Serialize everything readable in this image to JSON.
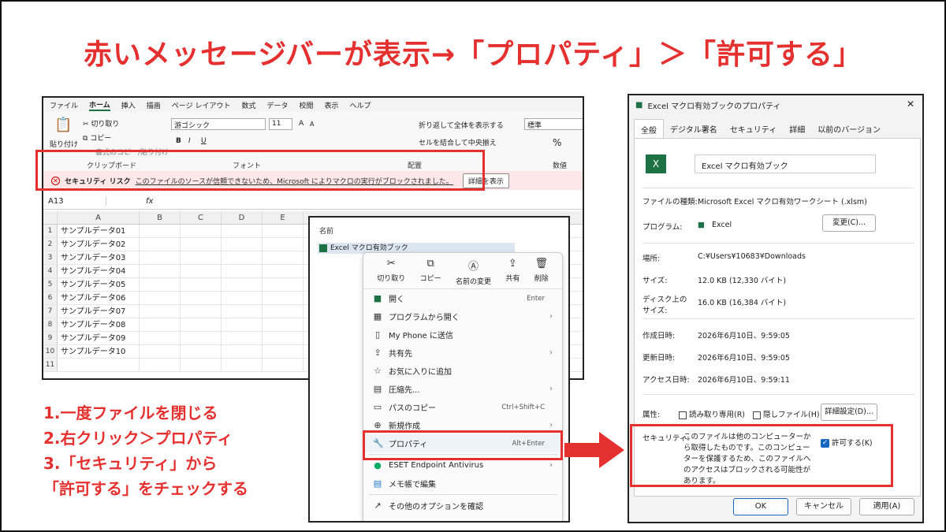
{
  "title": "赤いメッセージバーが表示→「プロパティ」＞「許可する」",
  "excel": {
    "menu": [
      "ファイル",
      "ホーム",
      "挿入",
      "描画",
      "ページ レイアウト",
      "数式",
      "データ",
      "校閲",
      "表示",
      "ヘルプ"
    ],
    "clipboard": {
      "paste": "貼り付け",
      "cut": "切り取り",
      "copy": "コピー",
      "format": "書式のコピー/貼り付け",
      "label": "クリップボード"
    },
    "font": {
      "name": "游ゴシック",
      "size": "11",
      "grow": "A",
      "shrink": "A",
      "bold": "B",
      "italic": "I",
      "underline": "U",
      "label": "フォント"
    },
    "align": {
      "wrap": "折り返して全体を表示する",
      "merge": "セルを結合して中央揃え",
      "label": "配置"
    },
    "number": {
      "format": "標準",
      "label": "数値",
      "percent": "%"
    },
    "security": {
      "heading": "セキュリティ リスク",
      "message": "このファイルのソースが信頼できないため、Microsoft によりマクロの実行がブロックされました。",
      "button": "詳細を表示"
    },
    "namebox": "A13",
    "fx": "fx",
    "columns": [
      "A",
      "B",
      "C",
      "D",
      "E"
    ],
    "rows": [
      {
        "n": "1",
        "v": "サンプルデータ01"
      },
      {
        "n": "2",
        "v": "サンプルデータ02"
      },
      {
        "n": "3",
        "v": "サンプルデータ03"
      },
      {
        "n": "4",
        "v": "サンプルデータ04"
      },
      {
        "n": "5",
        "v": "サンプルデータ05"
      },
      {
        "n": "6",
        "v": "サンプルデータ06"
      },
      {
        "n": "7",
        "v": "サンプルデータ07"
      },
      {
        "n": "8",
        "v": "サンプルデータ08"
      },
      {
        "n": "9",
        "v": "サンプルデータ09"
      },
      {
        "n": "10",
        "v": "サンプルデータ10"
      },
      {
        "n": "11",
        "v": ""
      }
    ]
  },
  "explorer": {
    "header": "名前",
    "file": "Excel マクロ有効ブック",
    "top_actions": [
      "切り取り",
      "コピー",
      "名前の変更",
      "共有",
      "削除"
    ],
    "items": [
      {
        "label": "開く",
        "shortcut": "Enter",
        "arrow": ""
      },
      {
        "label": "プログラムから開く",
        "shortcut": "",
        "arrow": "›"
      },
      {
        "label": "My Phone に送信",
        "shortcut": "",
        "arrow": ""
      },
      {
        "label": "共有先",
        "shortcut": "",
        "arrow": "›"
      },
      {
        "label": "お気に入りに追加",
        "shortcut": "",
        "arrow": ""
      },
      {
        "label": "圧縮先...",
        "shortcut": "",
        "arrow": "›"
      },
      {
        "label": "パスのコピー",
        "shortcut": "Ctrl+Shift+C",
        "arrow": ""
      },
      {
        "label": "新規作成",
        "shortcut": "",
        "arrow": "›"
      },
      {
        "label": "プロパティ",
        "shortcut": "Alt+Enter",
        "arrow": ""
      },
      {
        "label": "ESET Endpoint Antivirus",
        "shortcut": "",
        "arrow": "›"
      },
      {
        "label": "メモ帳で編集",
        "shortcut": "",
        "arrow": ""
      },
      {
        "label": "その他のオプションを確認",
        "shortcut": "",
        "arrow": ""
      }
    ]
  },
  "props": {
    "title": "Excel マクロ有効ブックのプロパティ",
    "tabs": [
      "全般",
      "デジタル署名",
      "セキュリティ",
      "詳細",
      "以前のバージョン"
    ],
    "filename": "Excel マクロ有効ブック",
    "type_label": "ファイルの種類:",
    "type_value": "Microsoft Excel マクロ有効ワークシート (.xlsm)",
    "prog_label": "プログラム:",
    "prog_value": "Excel",
    "change_btn": "変更(C)...",
    "loc_label": "場所:",
    "loc_value": "C:¥Users¥10683¥Downloads",
    "size_label": "サイズ:",
    "size_value": "12.0 KB (12,330 バイト)",
    "disk_label": "ディスク上のサイズ:",
    "disk_value": "16.0 KB (16,384 バイト)",
    "created_label": "作成日時:",
    "created_value": "2026年6月10日、9:59:05",
    "modified_label": "更新日時:",
    "modified_value": "2026年6月10日、9:59:05",
    "access_label": "アクセス日時:",
    "access_value": "2026年6月10日、9:59:11",
    "attr_label": "属性:",
    "readonly": "読み取り専用(R)",
    "hidden": "隠しファイル(H)",
    "advanced": "詳細設定(D)...",
    "sec_label": "セキュリティ:",
    "sec_text": "このファイルは他のコンピューターから取得したものです。このコンピューターを保護するため、このファイルへのアクセスはブロックされる可能性があります。",
    "allow": "許可する(K)",
    "ok": "OK",
    "cancel": "キャンセル",
    "apply": "適用(A)"
  },
  "steps": [
    "1.一度ファイルを閉じる",
    "2.右クリック＞プロパティ",
    "3.「セキュリティ」から",
    "「許可する」をチェックする"
  ],
  "colors": {
    "accent": "#e53030",
    "excel": "#1e7145"
  }
}
